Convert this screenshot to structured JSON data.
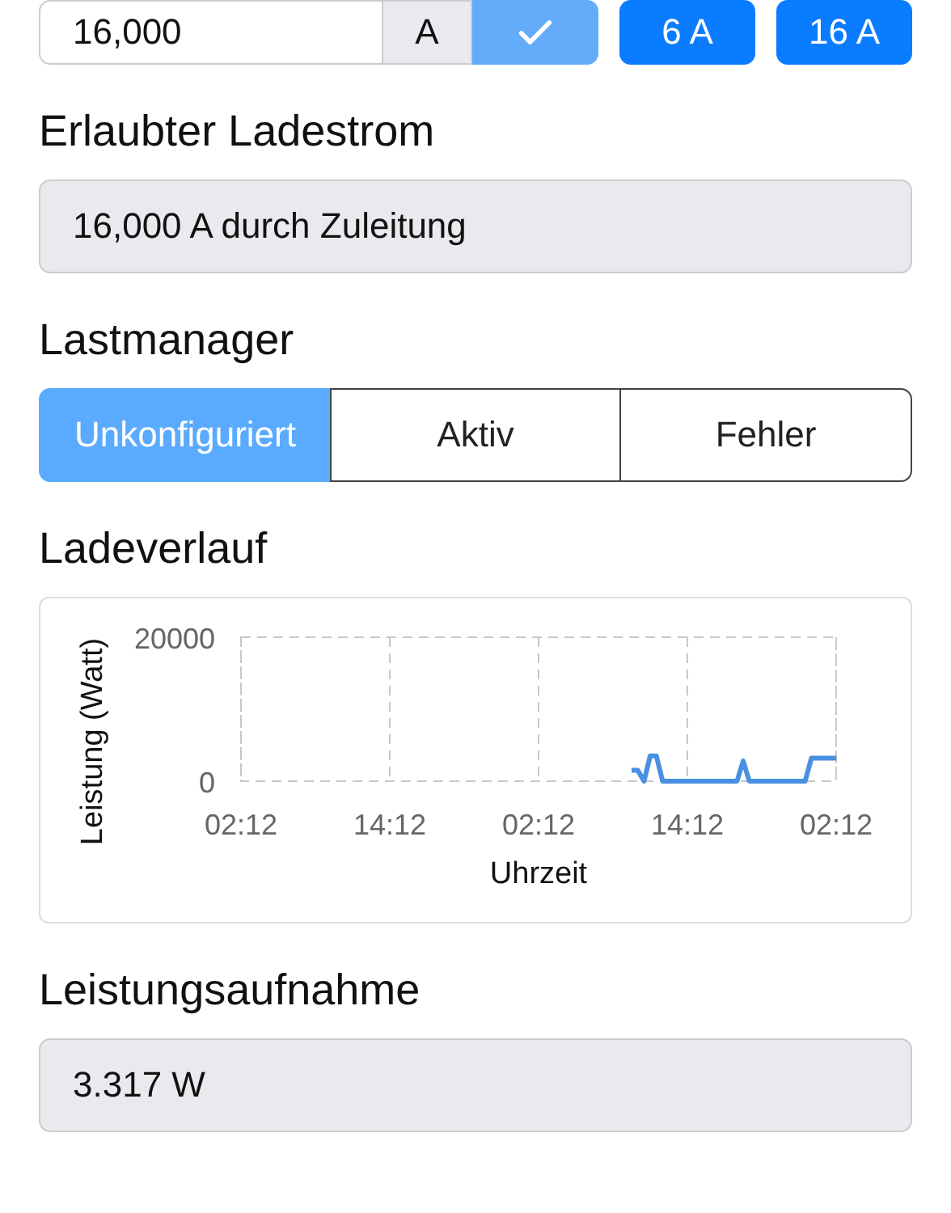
{
  "current_input": {
    "value": "16,000",
    "unit": "A",
    "presets": [
      "6 A",
      "16 A"
    ]
  },
  "allowed_current": {
    "title": "Erlaubter Ladestrom",
    "value": "16,000 A durch Zuleitung"
  },
  "load_manager": {
    "title": "Lastmanager",
    "options": [
      {
        "label": "Unkonfiguriert",
        "selected": true
      },
      {
        "label": "Aktiv",
        "selected": false
      },
      {
        "label": "Fehler",
        "selected": false
      }
    ]
  },
  "charging_history": {
    "title": "Ladeverlauf",
    "chart_data": {
      "type": "line",
      "xlabel": "Uhrzeit",
      "ylabel": "Leistung (Watt)",
      "ylim": [
        0,
        20000
      ],
      "yticks": [
        0,
        20000
      ],
      "categories": [
        "02:12",
        null,
        null,
        null,
        null,
        null,
        null,
        null,
        null,
        null,
        null,
        null,
        null,
        null,
        null,
        null,
        null,
        null,
        null,
        null,
        null,
        null,
        null,
        null,
        "14:12",
        null,
        null,
        null,
        null,
        null,
        null,
        null,
        null,
        null,
        null,
        null,
        null,
        null,
        null,
        null,
        null,
        null,
        null,
        null,
        null,
        null,
        null,
        null,
        "02:12",
        null,
        null,
        null,
        null,
        null,
        null,
        null,
        null,
        null,
        null,
        null,
        null,
        null,
        null,
        null,
        null,
        null,
        null,
        null,
        null,
        null,
        null,
        null,
        "14:12",
        null,
        null,
        null,
        null,
        null,
        null,
        null,
        null,
        null,
        null,
        null,
        null,
        null,
        null,
        null,
        null,
        null,
        null,
        null,
        null,
        null,
        null,
        null,
        "02:12"
      ],
      "series": [
        {
          "color": "#4a90e2",
          "values": [
            null,
            null,
            null,
            null,
            null,
            null,
            null,
            null,
            null,
            null,
            null,
            null,
            null,
            null,
            null,
            null,
            null,
            null,
            null,
            null,
            null,
            null,
            null,
            null,
            null,
            null,
            null,
            null,
            null,
            null,
            null,
            null,
            null,
            null,
            null,
            null,
            null,
            null,
            null,
            null,
            null,
            null,
            null,
            null,
            null,
            null,
            null,
            null,
            null,
            null,
            null,
            null,
            null,
            null,
            null,
            null,
            null,
            null,
            null,
            null,
            null,
            null,
            null,
            1500,
            1500,
            0,
            3500,
            3500,
            0,
            0,
            0,
            0,
            0,
            0,
            0,
            0,
            0,
            0,
            0,
            0,
            0,
            2800,
            0,
            0,
            0,
            0,
            0,
            0,
            0,
            0,
            0,
            0,
            3200,
            3200,
            3200,
            3200,
            3200
          ]
        }
      ]
    }
  },
  "power_consumption": {
    "title": "Leistungsaufnahme",
    "value": "3.317 W"
  }
}
